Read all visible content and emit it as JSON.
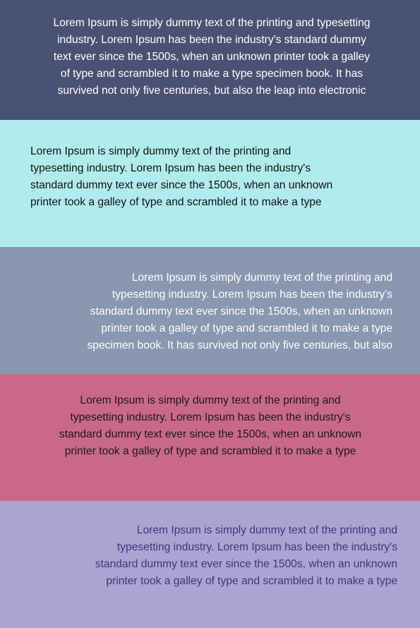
{
  "blocks": [
    {
      "text": "Lorem Ipsum is simply dummy text of the printing and typesetting\nindustry. Lorem Ipsum has been the industry's standard dummy\ntext ever since the 1500s, when an unknown printer took a galley\nof type and scrambled it to make a type specimen book. It has\nsurvived not only five centuries, but also the leap into electronic",
      "background": "#4a5273",
      "color": "#ffffff"
    },
    {
      "text": "Lorem Ipsum is simply dummy text of the printing and\ntypesetting industry. Lorem Ipsum has been the industry's\nstandard dummy text ever since the 1500s, when an unknown\nprinter took a galley of type and scrambled it to make a type",
      "background": "#b0ecec",
      "color": "#111111"
    },
    {
      "text": "Lorem Ipsum is simply dummy text of the printing and\ntypesetting industry. Lorem Ipsum has been the industry's\nstandard dummy text ever since the 1500s, when an unknown\nprinter took a galley of type and scrambled it to make a type\nspecimen book. It has survived not only five centuries, but also",
      "background": "#8a97b0",
      "color": "#ffffff"
    },
    {
      "text": "Lorem Ipsum is simply dummy text of the printing and\ntypesetting industry. Lorem Ipsum has been the industry's\nstandard dummy text ever since the 1500s, when an unknown\nprinter took a galley of type and scrambled it to make a type",
      "background": "#c96987",
      "color": "#1a1a1a"
    },
    {
      "text": "Lorem Ipsum is simply dummy text of the printing and\ntypesetting industry. Lorem Ipsum has been the industry's\nstandard dummy text ever since the 1500s, when an unknown\nprinter took a galley of type and scrambled it to make a type",
      "background": "#ada3d0",
      "color": "#383a78"
    }
  ]
}
